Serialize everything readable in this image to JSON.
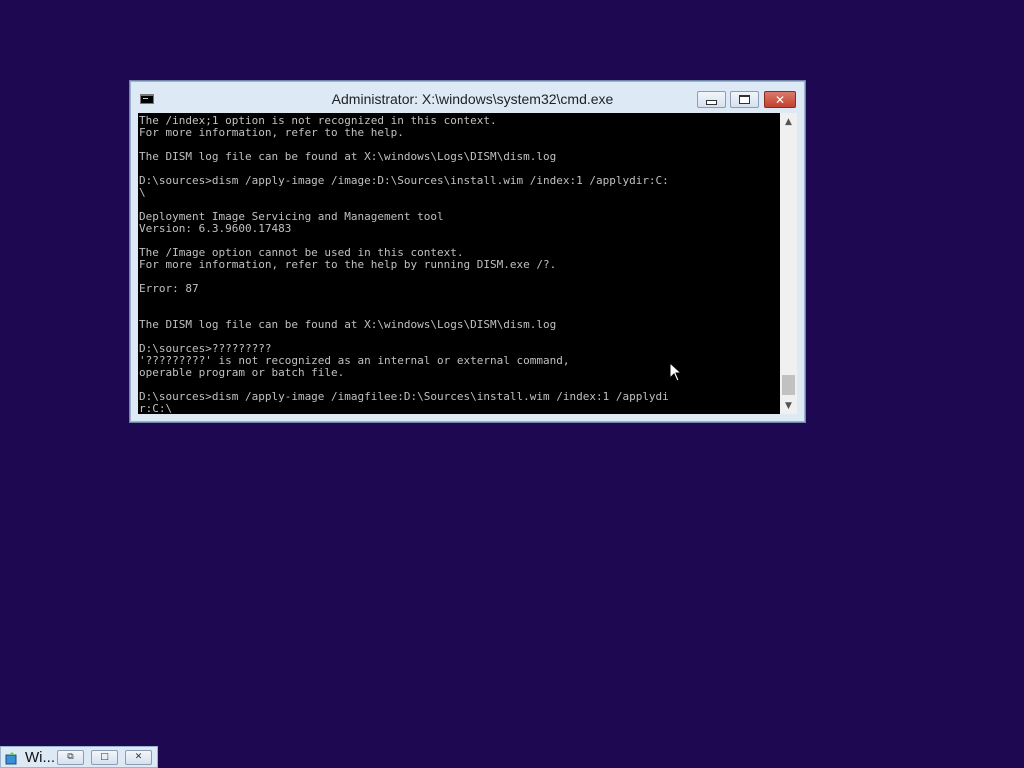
{
  "window": {
    "title": "Administrator: X:\\windows\\system32\\cmd.exe",
    "icon": "cmd-icon",
    "buttons": {
      "minimize_icon": "minimize-icon",
      "maximize_icon": "maximize-icon",
      "close_icon": "close-icon",
      "close_glyph": "✕"
    }
  },
  "console": {
    "text_color": "#c0c0c0",
    "background": "#000000",
    "lines": "The /index;1 option is not recognized in this context.\nFor more information, refer to the help.\n\nThe DISM log file can be found at X:\\windows\\Logs\\DISM\\dism.log\n\nD:\\sources>dism /apply-image /image:D:\\Sources\\install.wim /index:1 /applydir:C:\n\\\n\nDeployment Image Servicing and Management tool\nVersion: 6.3.9600.17483\n\nThe /Image option cannot be used in this context.\nFor more information, refer to the help by running DISM.exe /?.\n\nError: 87\n\n\nThe DISM log file can be found at X:\\windows\\Logs\\DISM\\dism.log\n\nD:\\sources>?????????\n'?????????' is not recognized as an internal or external command,\noperable program or batch file.\n\nD:\\sources>dism /apply-image /imagfilee:D:\\Sources\\install.wim /index:1 /applydi\nr:C:\\"
  },
  "scrollbar": {
    "up_glyph": "▲",
    "down_glyph": "▼"
  },
  "taskbar": {
    "label": "Wi...",
    "restore_glyph": "⧉",
    "maximize_glyph": "□",
    "close_glyph": "✕"
  },
  "colors": {
    "desktop": "#1e0852",
    "window_frame": "#dde9f5",
    "close_button": "#c4412e"
  }
}
